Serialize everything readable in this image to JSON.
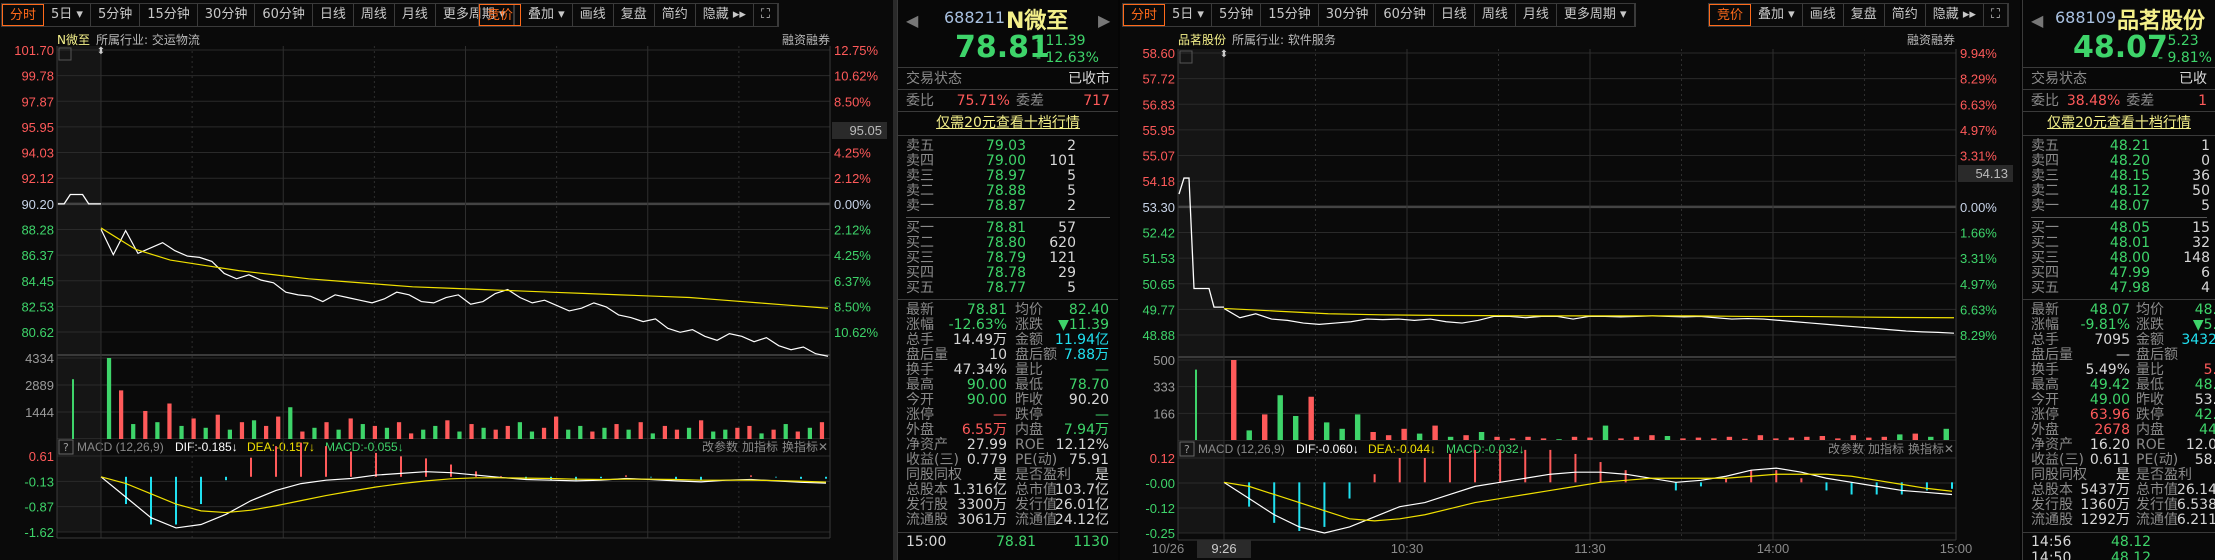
{
  "toolbar": {
    "periods": [
      "分时",
      "5日 ▾",
      "5分钟",
      "15分钟",
      "30分钟",
      "60分钟",
      "日线",
      "周线",
      "月线",
      "更多周期 ▾"
    ],
    "tools": [
      "竞价",
      "叠加 ▾",
      "画线",
      "复盘",
      "简约",
      "隐藏 ▸▸"
    ],
    "fullscreen_icon": "expand-icon"
  },
  "charts": [
    {
      "stock_name": "N微至",
      "industry": "所属行业: 交运物流",
      "margin_label": "融资融券",
      "price_labels": [
        "101.70",
        "99.78",
        "97.87",
        "95.95",
        "94.03",
        "92.12",
        "90.20",
        "88.28",
        "86.37",
        "84.45",
        "82.53",
        "80.62"
      ],
      "pct_labels": [
        "12.75%",
        "10.62%",
        "8.50%",
        "6.37%",
        "4.25%",
        "2.12%",
        "0.00%",
        "2.12%",
        "4.25%",
        "6.37%",
        "8.50%",
        "10.62%"
      ],
      "cursor_price": "95.05",
      "volume_labels": [
        "4334",
        "2889",
        "1444"
      ],
      "macd_labels": [
        "0.61",
        "-0.13",
        "-0.87",
        "-1.62"
      ],
      "macd_header": {
        "name": "MACD (12,26,9)",
        "dif": "DIF:-0.185↓",
        "dea": "DEA:-0.157↓",
        "macd": "MACD:-0.055↓",
        "actions": [
          "改参数",
          "加指标",
          "换指标"
        ]
      },
      "time_labels": [],
      "chart_data": {
        "type": "line",
        "price_range": [
          80.62,
          101.7
        ],
        "prev_close": 90.2,
        "volume_range": [
          0,
          4334
        ],
        "macd_range": [
          -1.62,
          0.61
        ],
        "auction_prices": [
          90.2,
          90.2,
          90.9,
          90.9,
          90.9,
          90.2,
          90.2,
          90.2
        ],
        "auction_volume": 3200,
        "prices": [
          88.3,
          86.4,
          88.2,
          86.5,
          86.9,
          87.3,
          86.7,
          86.3,
          86.2,
          85.9,
          85.0,
          84.6,
          84.9,
          84.5,
          84.3,
          83.6,
          83.4,
          83.3,
          82.9,
          83.4,
          83.2,
          83.0,
          82.8,
          83.1,
          83.6,
          83.4,
          82.9,
          82.8,
          83.2,
          83.4,
          82.7,
          82.9,
          83.5,
          83.8,
          83.2,
          82.8,
          83.0,
          82.6,
          82.2,
          82.4,
          82.8,
          82.5,
          81.9,
          81.7,
          81.4,
          81.6,
          80.9,
          80.6,
          80.8,
          80.3,
          80.0,
          80.5,
          80.3,
          79.9,
          80.2,
          79.6,
          79.3,
          79.5,
          79.0,
          78.81
        ],
        "avg_prices": [
          88.4,
          86.8,
          86.0,
          85.6,
          85.2,
          84.9,
          84.6,
          84.4,
          84.2,
          84.0,
          83.9,
          83.8,
          83.7,
          83.6,
          83.5,
          83.4,
          83.3,
          83.2,
          83.0,
          82.8,
          82.6,
          82.4
        ],
        "volumes": [
          4334,
          2600,
          800,
          1500,
          900,
          1900,
          700,
          1100,
          600,
          1300,
          500,
          900,
          1000,
          700,
          1200,
          1700,
          400,
          600,
          900,
          500,
          1100,
          800,
          700,
          600,
          900,
          300,
          500,
          700,
          1000,
          400,
          800,
          600,
          500,
          700,
          900,
          400,
          600,
          1200,
          500,
          700,
          400,
          600,
          800,
          500,
          900,
          300,
          700,
          500,
          600,
          1000,
          400,
          500,
          600,
          700,
          300,
          500,
          800,
          400,
          600,
          900
        ],
        "volume_dirs": [
          "down",
          "up",
          "down",
          "up",
          "down",
          "up",
          "down",
          "up",
          "down",
          "up",
          "down",
          "up",
          "down",
          "up",
          "up",
          "down",
          "up",
          "down",
          "up",
          "down",
          "up",
          "down",
          "up",
          "down",
          "up",
          "up",
          "down",
          "down",
          "up",
          "down",
          "up",
          "down",
          "up",
          "up",
          "down",
          "down",
          "up",
          "up",
          "down",
          "down",
          "up",
          "down",
          "up",
          "down",
          "up",
          "down",
          "up",
          "up",
          "down",
          "up",
          "down",
          "down",
          "up",
          "up",
          "down",
          "up",
          "down",
          "up",
          "down",
          "up"
        ],
        "dif": [
          0,
          -0.6,
          -1.2,
          -1.5,
          -1.4,
          -1.1,
          -0.7,
          -0.4,
          -0.2,
          -0.1,
          -0.05,
          0.05,
          0.1,
          0.15,
          0.12,
          0.05,
          -0.02,
          -0.08,
          -0.1,
          -0.12,
          -0.1,
          -0.05,
          -0.08,
          -0.12,
          -0.15,
          -0.1,
          -0.08,
          -0.12,
          -0.16,
          -0.185
        ],
        "dea": [
          0,
          -0.2,
          -0.5,
          -0.8,
          -1.0,
          -1.05,
          -0.98,
          -0.85,
          -0.7,
          -0.55,
          -0.42,
          -0.3,
          -0.2,
          -0.12,
          -0.06,
          -0.03,
          -0.03,
          -0.04,
          -0.05,
          -0.07,
          -0.08,
          -0.07,
          -0.07,
          -0.08,
          -0.1,
          -0.1,
          -0.1,
          -0.11,
          -0.13,
          -0.157
        ]
      }
    },
    {
      "stock_name": "品茗股份",
      "industry": "所属行业: 软件服务",
      "margin_label": "融资融券",
      "price_labels": [
        "58.60",
        "57.72",
        "56.83",
        "55.95",
        "55.07",
        "54.18",
        "53.30",
        "52.42",
        "51.53",
        "50.65",
        "49.77",
        "48.88"
      ],
      "pct_labels": [
        "9.94%",
        "8.29%",
        "6.63%",
        "4.97%",
        "3.31%",
        "1.66%",
        "0.00%",
        "1.66%",
        "3.31%",
        "4.97%",
        "6.63%",
        "8.29%"
      ],
      "cursor_price": "54.13",
      "volume_labels": [
        "500",
        "333",
        "166"
      ],
      "macd_labels": [
        "0.12",
        "-0.00",
        "-0.12",
        "-0.25"
      ],
      "macd_header": {
        "name": "MACD (12,26,9)",
        "dif": "DIF:-0.060↓",
        "dea": "DEA:-0.044↓",
        "macd": "MACD:-0.032↓",
        "actions": [
          "改参数",
          "加指标",
          "换指标"
        ]
      },
      "time_labels": [
        "10/26",
        "9:26",
        "10:30",
        "11:30",
        "14:00",
        "15:00"
      ],
      "chart_data": {
        "type": "line",
        "price_range": [
          48.0,
          58.6
        ],
        "prev_close": 53.3,
        "volume_range": [
          0,
          500
        ],
        "macd_range": [
          -0.25,
          0.12
        ],
        "auction_prices": [
          53.3,
          53.9,
          53.9,
          49.75,
          49.75,
          49.75,
          49.75,
          49.05,
          49.05,
          49.05
        ],
        "auction_volume": 440,
        "prices": [
          49.0,
          48.65,
          48.8,
          48.6,
          48.55,
          48.45,
          48.4,
          48.45,
          48.5,
          48.6,
          48.58,
          48.6,
          48.55,
          48.6,
          48.5,
          48.45,
          48.55,
          48.7,
          48.7,
          48.65,
          48.7,
          48.7,
          48.6,
          48.7,
          48.7,
          48.68,
          48.7,
          48.72,
          48.7,
          48.68,
          48.7,
          48.65,
          48.6,
          48.62,
          48.6,
          48.55,
          48.5,
          48.45,
          48.4,
          48.35,
          48.3,
          48.25,
          48.2,
          48.15,
          48.12,
          48.1,
          48.07
        ],
        "avg_prices": [
          49.0,
          48.9,
          48.8,
          48.76,
          48.74,
          48.73,
          48.72,
          48.72,
          48.72,
          48.72,
          48.7,
          48.7,
          48.68,
          48.66,
          48.65
        ],
        "volumes": [
          500,
          60,
          160,
          280,
          150,
          270,
          110,
          70,
          160,
          50,
          30,
          70,
          40,
          90,
          20,
          30,
          50,
          20,
          10,
          20,
          10,
          5,
          20,
          15,
          90,
          10,
          20,
          30,
          25,
          10,
          15,
          10,
          20,
          8,
          30,
          10,
          15,
          20,
          25,
          10,
          30,
          15,
          20,
          35,
          40,
          20,
          70
        ],
        "volume_dirs": [
          "up",
          "down",
          "up",
          "down",
          "down",
          "up",
          "down",
          "down",
          "down",
          "up",
          "up",
          "up",
          "down",
          "up",
          "down",
          "up",
          "down",
          "up",
          "up",
          "up",
          "up",
          "down",
          "up",
          "up",
          "down",
          "up",
          "up",
          "up",
          "down",
          "up",
          "up",
          "up",
          "up",
          "up",
          "up",
          "up",
          "up",
          "up",
          "up",
          "up",
          "up",
          "up",
          "up",
          "down",
          "up",
          "down",
          "down"
        ],
        "dif": [
          0,
          -0.08,
          -0.16,
          -0.22,
          -0.25,
          -0.22,
          -0.17,
          -0.12,
          -0.1,
          -0.06,
          -0.02,
          0.0,
          0.02,
          0.04,
          0.05,
          0.05,
          0.04,
          0.02,
          0.0,
          0.01,
          0.03,
          0.06,
          0.07,
          0.05,
          0.02,
          0.0,
          -0.02,
          -0.04,
          -0.05,
          -0.06
        ],
        "dea": [
          0,
          -0.02,
          -0.06,
          -0.1,
          -0.14,
          -0.18,
          -0.19,
          -0.18,
          -0.16,
          -0.13,
          -0.1,
          -0.08,
          -0.06,
          -0.04,
          -0.02,
          0.0,
          0.01,
          0.02,
          0.02,
          0.02,
          0.02,
          0.03,
          0.04,
          0.04,
          0.04,
          0.03,
          0.01,
          -0.01,
          -0.03,
          -0.044
        ]
      }
    }
  ],
  "quotes": [
    {
      "code": "688211",
      "name": "N微至",
      "price": "78.81",
      "change": "- 11.39",
      "change_pct": "- 12.63%",
      "status_label": "交易状态",
      "status": "已收市",
      "wb_label": "委比",
      "wb": "75.71%",
      "wc_label": "委差",
      "wc": "717",
      "promo": "仅需20元查看十档行情",
      "asks": [
        [
          "卖五",
          "79.03",
          "2"
        ],
        [
          "卖四",
          "79.00",
          "101"
        ],
        [
          "卖三",
          "78.97",
          "5"
        ],
        [
          "卖二",
          "78.88",
          "5"
        ],
        [
          "卖一",
          "78.87",
          "2"
        ]
      ],
      "bids": [
        [
          "买一",
          "78.81",
          "57"
        ],
        [
          "买二",
          "78.80",
          "620"
        ],
        [
          "买三",
          "78.79",
          "121"
        ],
        [
          "买四",
          "78.78",
          "29"
        ],
        [
          "买五",
          "78.77",
          "5"
        ]
      ],
      "stats": [
        [
          "最新",
          "78.81",
          "g",
          "均价",
          "82.40",
          "g"
        ],
        [
          "涨幅",
          "-12.63%",
          "g",
          "涨跌",
          "▼11.39",
          "g"
        ],
        [
          "总手",
          "14.49万",
          "w",
          "金额",
          "11.94亿",
          "c"
        ],
        [
          "盘后量",
          "10",
          "w",
          "盘后额",
          "7.88万",
          "c"
        ],
        [
          "换手",
          "47.34%",
          "w",
          "量比",
          "—",
          "g"
        ],
        [
          "最高",
          "90.00",
          "g",
          "最低",
          "78.70",
          "g"
        ],
        [
          "今开",
          "90.00",
          "g",
          "昨收",
          "90.20",
          "w"
        ],
        [
          "涨停",
          "—",
          "r",
          "跌停",
          "—",
          "g"
        ],
        [
          "外盘",
          "6.55万",
          "r",
          "内盘",
          "7.94万",
          "g"
        ],
        [
          "净资产",
          "27.99",
          "w",
          "ROE",
          "12.12%",
          "w"
        ],
        [
          "收益(三)",
          "0.779",
          "w",
          "PE(动)",
          "75.91",
          "w"
        ],
        [
          "同股同权",
          "是",
          "w",
          "是否盈利",
          "是",
          "w"
        ],
        [
          "总股本",
          "1.316亿",
          "w",
          "总市值",
          "103.7亿",
          "w"
        ],
        [
          "发行股",
          "3300万",
          "w",
          "发行值",
          "26.01亿",
          "w"
        ],
        [
          "流通股",
          "3061万",
          "w",
          "流通值",
          "24.12亿",
          "w"
        ]
      ],
      "ticks": [
        [
          "15:00",
          "78.81",
          "1130"
        ]
      ]
    },
    {
      "code": "688109",
      "name": "品茗股份",
      "price": "48.07",
      "change": "- 5.23",
      "change_pct": "- 9.81%",
      "status_label": "交易状态",
      "status": "已收",
      "wb_label": "委比",
      "wb": "38.48%",
      "wc_label": "委差",
      "wc": "1",
      "promo": "仅需20元查看十档行情",
      "asks": [
        [
          "卖五",
          "48.21",
          "1"
        ],
        [
          "卖四",
          "48.20",
          "0"
        ],
        [
          "卖三",
          "48.15",
          "36"
        ],
        [
          "卖二",
          "48.12",
          "50"
        ],
        [
          "卖一",
          "48.07",
          "5"
        ]
      ],
      "bids": [
        [
          "买一",
          "48.05",
          "15"
        ],
        [
          "买二",
          "48.01",
          "32"
        ],
        [
          "买三",
          "48.00",
          "148"
        ],
        [
          "买四",
          "47.99",
          "6"
        ],
        [
          "买五",
          "47.98",
          "4"
        ]
      ],
      "stats": [
        [
          "最新",
          "48.07",
          "g",
          "均价",
          "48.",
          "g"
        ],
        [
          "涨幅",
          "-9.81%",
          "g",
          "涨跌",
          "▼5.",
          "g"
        ],
        [
          "总手",
          "7095",
          "w",
          "金额",
          "3432",
          "c"
        ],
        [
          "盘后量",
          "—",
          "w",
          "盘后额",
          "",
          "c"
        ],
        [
          "换手",
          "5.49%",
          "w",
          "量比",
          "5.",
          "r"
        ],
        [
          "最高",
          "49.42",
          "g",
          "最低",
          "48.",
          "g"
        ],
        [
          "今开",
          "49.00",
          "g",
          "昨收",
          "53.",
          "w"
        ],
        [
          "涨停",
          "63.96",
          "r",
          "跌停",
          "42.",
          "g"
        ],
        [
          "外盘",
          "2678",
          "r",
          "内盘",
          "44",
          "g"
        ],
        [
          "净资产",
          "16.20",
          "w",
          "ROE",
          "12.0",
          "w"
        ],
        [
          "收益(三)",
          "0.611",
          "w",
          "PE(动)",
          "58.",
          "w"
        ],
        [
          "同股同权",
          "是",
          "w",
          "是否盈利",
          "",
          "w"
        ],
        [
          "总股本",
          "5437万",
          "w",
          "总市值",
          "26.14",
          "w"
        ],
        [
          "发行股",
          "1360万",
          "w",
          "发行值",
          "6.538",
          "w"
        ],
        [
          "流通股",
          "1292万",
          "w",
          "流通值",
          "6.211",
          "w"
        ]
      ],
      "ticks": [
        [
          "14:56",
          "48.12",
          ""
        ],
        [
          "14:50",
          "48.12",
          ""
        ]
      ]
    }
  ],
  "colors": {
    "up": "#ff5a5a",
    "down": "#3ed46a",
    "price_line": "#ffffff",
    "avg_line": "#f0e000",
    "accent": "#ff6a1a",
    "dif": "#ffffff",
    "dea": "#f0e000",
    "hist_neg": "#20e0f0",
    "hist_pos": "#ff5a5a"
  }
}
